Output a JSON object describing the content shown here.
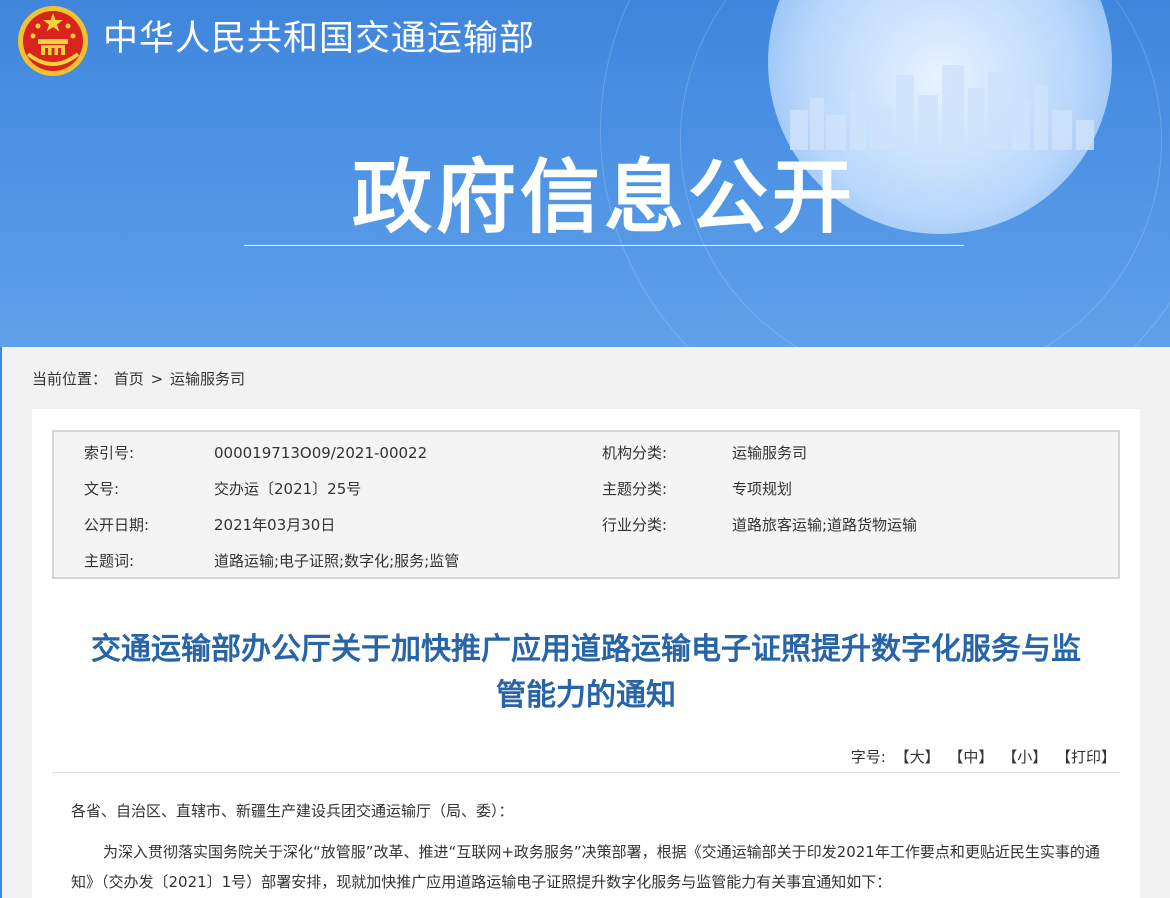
{
  "header": {
    "site_name": "中华人民共和国交通运输部",
    "banner_title": "政府信息公开",
    "colors": {
      "banner_blue": "#4a8fe2",
      "title_blue": "#2864a8"
    }
  },
  "breadcrumb": {
    "label": "当前位置：",
    "home": "首页",
    "separator": ">",
    "current": "运输服务司"
  },
  "meta": {
    "index_label": "索引号:",
    "index_value": "000019713O09/2021-00022",
    "org_label": "机构分类:",
    "org_value": "运输服务司",
    "doc_no_label": "文号:",
    "doc_no_value": "交办运〔2021〕25号",
    "topic_label": "主题分类:",
    "topic_value": "专项规划",
    "date_label": "公开日期:",
    "date_value": "2021年03月30日",
    "industry_label": "行业分类:",
    "industry_value": "道路旅客运输;道路货物运输",
    "keywords_label": "主题词:",
    "keywords_value": "道路运输;电子证照;数字化;服务;监管"
  },
  "article": {
    "title_line1": "交通运输部办公厅关于加快推广应用道路运输电子证照提升数字化服务与监",
    "title_line2": "管能力的通知",
    "font_label": "字号:",
    "font_large": "【大】",
    "font_medium": "【中】",
    "font_small": "【小】",
    "print": "【打印】",
    "salutation": "各省、自治区、直辖市、新疆生产建设兵团交通运输厅（局、委）：",
    "body": "为深入贯彻落实国务院关于深化“放管服”改革、推进“互联网+政务服务”决策部署，根据《交通运输部关于印发2021年工作要点和更贴近民生实事的通知》（交办发〔2021〕1号）部署安排，现就加快推广应用道路运输电子证照提升数字化服务与监管能力有关事宜通知如下："
  }
}
